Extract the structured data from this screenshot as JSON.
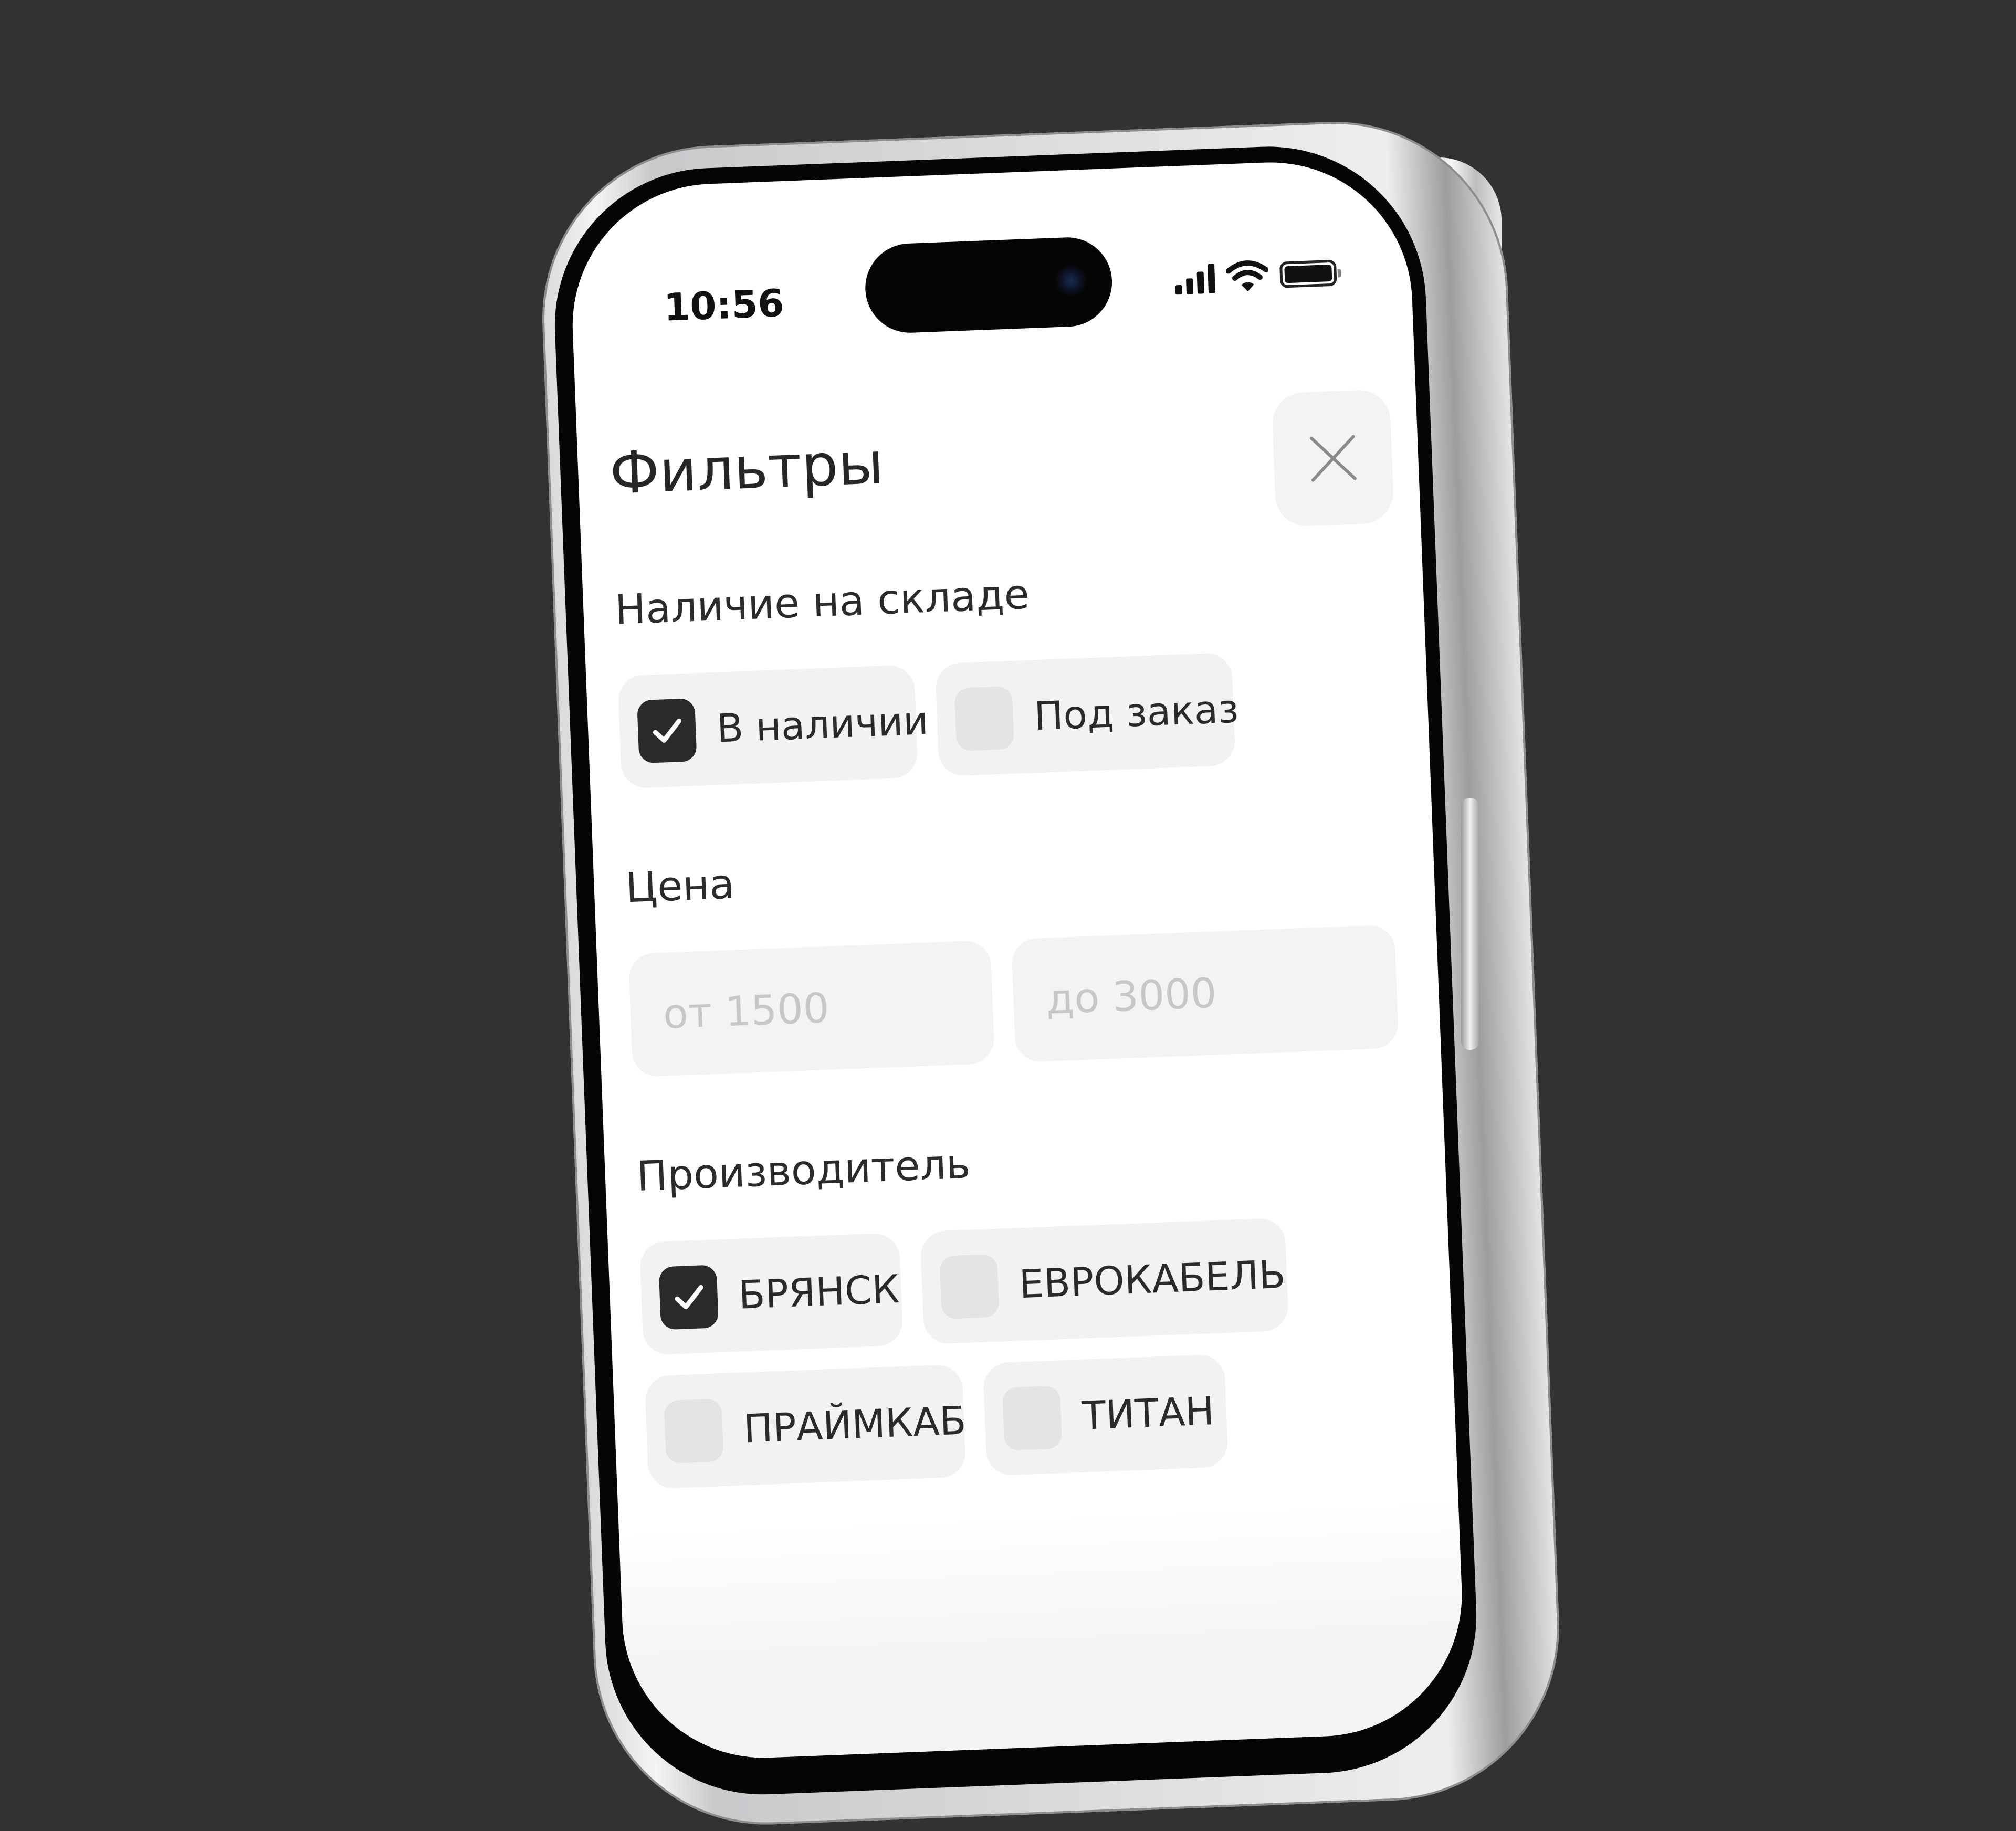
{
  "status_bar": {
    "time": "10:56",
    "icons": [
      "signal-icon",
      "wifi-icon",
      "battery-icon"
    ]
  },
  "header": {
    "title": "Фильтры",
    "close_icon": "close-icon"
  },
  "stock": {
    "label": "Наличие на складе",
    "options": [
      {
        "label": "В наличии",
        "checked": true
      },
      {
        "label": "Под заказ",
        "checked": false
      }
    ]
  },
  "price": {
    "label": "Цена",
    "from_placeholder": "от 1500",
    "to_placeholder": "до 3000"
  },
  "manufacturer": {
    "label": "Производитель",
    "options": [
      {
        "label": "БРЯНСК",
        "checked": true
      },
      {
        "label": "ЕВРОКАБЕЛЬ",
        "checked": false
      },
      {
        "label": "ПРАЙМКАБ",
        "checked": false
      },
      {
        "label": "ТИТАН",
        "checked": false
      }
    ]
  },
  "colors": {
    "background": "#323232",
    "chip": "#f2f2f2",
    "checked": "#2a2a2a",
    "text": "#2a2a2a"
  }
}
